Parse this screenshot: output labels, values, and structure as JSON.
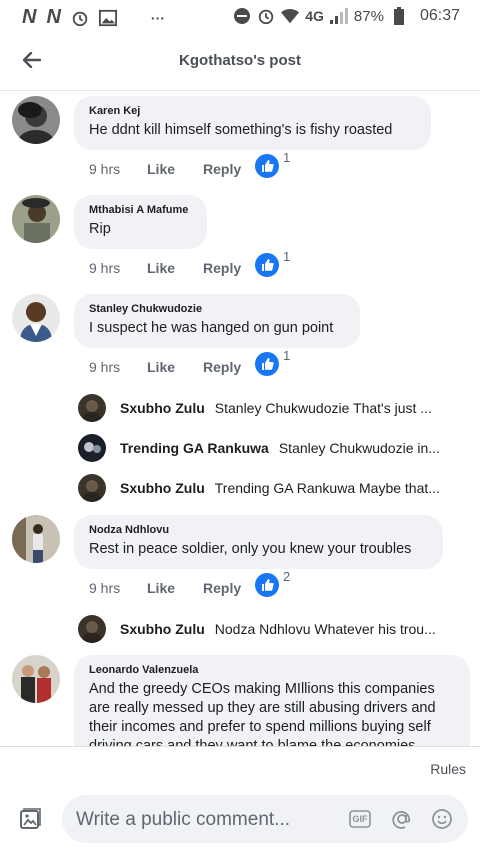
{
  "statusbar": {
    "left_icons": [
      "n-icon",
      "n-icon",
      "alarm-icon",
      "gallery-icon",
      "dots"
    ],
    "dots": "···",
    "network": "4G",
    "battery": "87%",
    "time": "06:37"
  },
  "header": {
    "title": "Kgothatso's post"
  },
  "comments": [
    {
      "author": "Karen Kej",
      "text": "He ddnt kill himself something's is fishy roasted",
      "time": "9 hrs",
      "like": "Like",
      "reply": "Reply",
      "reactions": "1"
    },
    {
      "author": "Mthabisi A Mafume",
      "text": "Rip",
      "time": "9 hrs",
      "like": "Like",
      "reply": "Reply",
      "reactions": "1"
    },
    {
      "author": "Stanley Chukwudozie",
      "text": "I suspect he was hanged on gun point",
      "time": "9 hrs",
      "like": "Like",
      "reply": "Reply",
      "reactions": "1",
      "replies": [
        {
          "name": "Sxubho Zulu",
          "text": "Stanley Chukwudozie That's just ..."
        },
        {
          "name": "Trending GA Rankuwa",
          "text": "Stanley Chukwudozie in..."
        },
        {
          "name": "Sxubho Zulu",
          "text": "Trending GA Rankuwa Maybe that..."
        }
      ]
    },
    {
      "author": "Nodza Ndhlovu",
      "text": "Rest in peace soldier, only you knew your troubles",
      "time": "9 hrs",
      "like": "Like",
      "reply": "Reply",
      "reactions": "2",
      "replies": [
        {
          "name": "Sxubho Zulu",
          "text": "Nodza Ndhlovu Whatever his trou..."
        }
      ]
    },
    {
      "author": "Leonardo Valenzuela",
      "text": "And the greedy CEOs making MIllions this companies are really messed up they are still abusing drivers and their incomes and prefer to spend millions buying self driving cars and they want to blame the economies"
    }
  ],
  "footer": {
    "rules": "Rules",
    "comment_placeholder": "Write a public comment...",
    "gif_label": "GIF"
  },
  "colors": {
    "like_blue": "#1877f2",
    "bubble": "#f0f2f5",
    "meta_gray": "#606770"
  }
}
